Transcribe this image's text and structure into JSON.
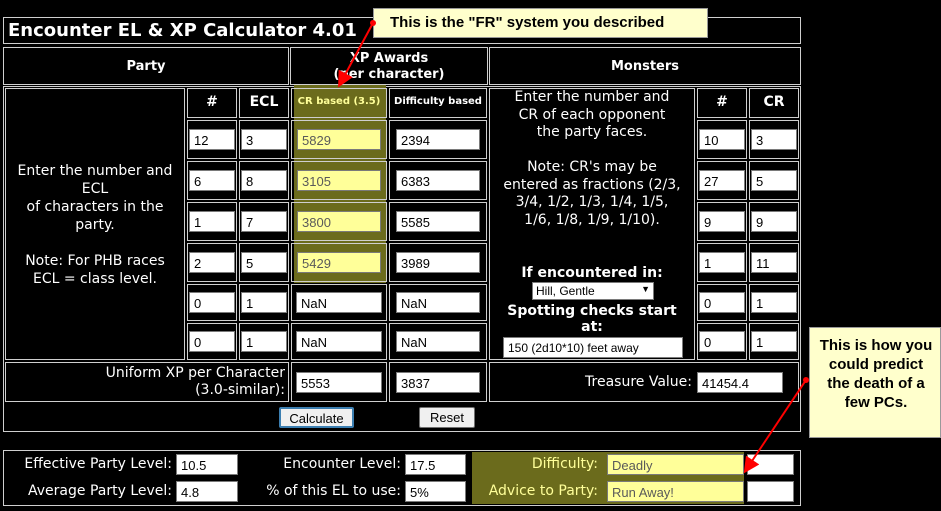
{
  "title": "Encounter EL & XP Calculator 4.01",
  "callout_fr": "This is the \"FR\" system you described",
  "callout_death": "This is how you could predict the death of a few PCs.",
  "headers": {
    "party": "Party",
    "xp_awards": "XP Awards\n(per character)",
    "monsters": "Monsters",
    "num": "#",
    "ecl": "ECL",
    "cr_based": "CR based (3.5)",
    "difficulty_based": "Difficulty based",
    "monster_num": "#",
    "cr": "CR"
  },
  "party_instructions": "Enter the number and\nECL\nof characters in the\nparty.\n\nNote: For PHB races\nECL = class level.",
  "monster_instructions": "Enter the number and\nCR of each opponent\nthe party faces.\n\nNote: CR's may be\nentered as fractions (2/3,\n3/4, 1/2, 1/3, 1/4, 1/5,\n1/6, 1/8, 1/9, 1/10).",
  "party_rows": [
    {
      "num": "12",
      "ecl": "3",
      "cr_xp": "5829",
      "diff_xp": "2394"
    },
    {
      "num": "6",
      "ecl": "8",
      "cr_xp": "3105",
      "diff_xp": "6383"
    },
    {
      "num": "1",
      "ecl": "7",
      "cr_xp": "3800",
      "diff_xp": "5585"
    },
    {
      "num": "2",
      "ecl": "5",
      "cr_xp": "5429",
      "diff_xp": "3989"
    },
    {
      "num": "0",
      "ecl": "1",
      "cr_xp": "NaN",
      "diff_xp": "NaN"
    },
    {
      "num": "0",
      "ecl": "1",
      "cr_xp": "NaN",
      "diff_xp": "NaN"
    }
  ],
  "monster_rows": [
    {
      "num": "10",
      "cr": "3"
    },
    {
      "num": "27",
      "cr": "5"
    },
    {
      "num": "9",
      "cr": "9"
    },
    {
      "num": "1",
      "cr": "11"
    },
    {
      "num": "0",
      "cr": "1"
    },
    {
      "num": "0",
      "cr": "1"
    }
  ],
  "encounter": {
    "label": "If encountered in:",
    "terrain": "Hill, Gentle",
    "spotting_label": "Spotting checks start\nat:",
    "spotting_value": "150 (2d10*10) feet away"
  },
  "uniform": {
    "label": "Uniform XP per Character\n(3.0-similar):",
    "cr_value": "5553",
    "diff_value": "3837"
  },
  "treasure": {
    "label": "Treasure Value:",
    "value": "41454.4"
  },
  "buttons": {
    "calculate": "Calculate",
    "reset": "Reset"
  },
  "summary": {
    "epl_label": "Effective Party Level:",
    "epl_value": "10.5",
    "el_label": "Encounter Level:",
    "el_value": "17.5",
    "difficulty_label": "Difficulty:",
    "difficulty_value": "Deadly",
    "apl_label": "Average Party Level:",
    "apl_value": "4.8",
    "pct_label": "% of this EL to use:",
    "pct_value": "5%",
    "advice_label": "Advice to Party:",
    "advice_value": "Run Away!"
  },
  "colors": {
    "highlight": "#ffff99",
    "olive": "#6b6b1c",
    "callout": "#ffffcc",
    "arrow": "#ff0000"
  }
}
